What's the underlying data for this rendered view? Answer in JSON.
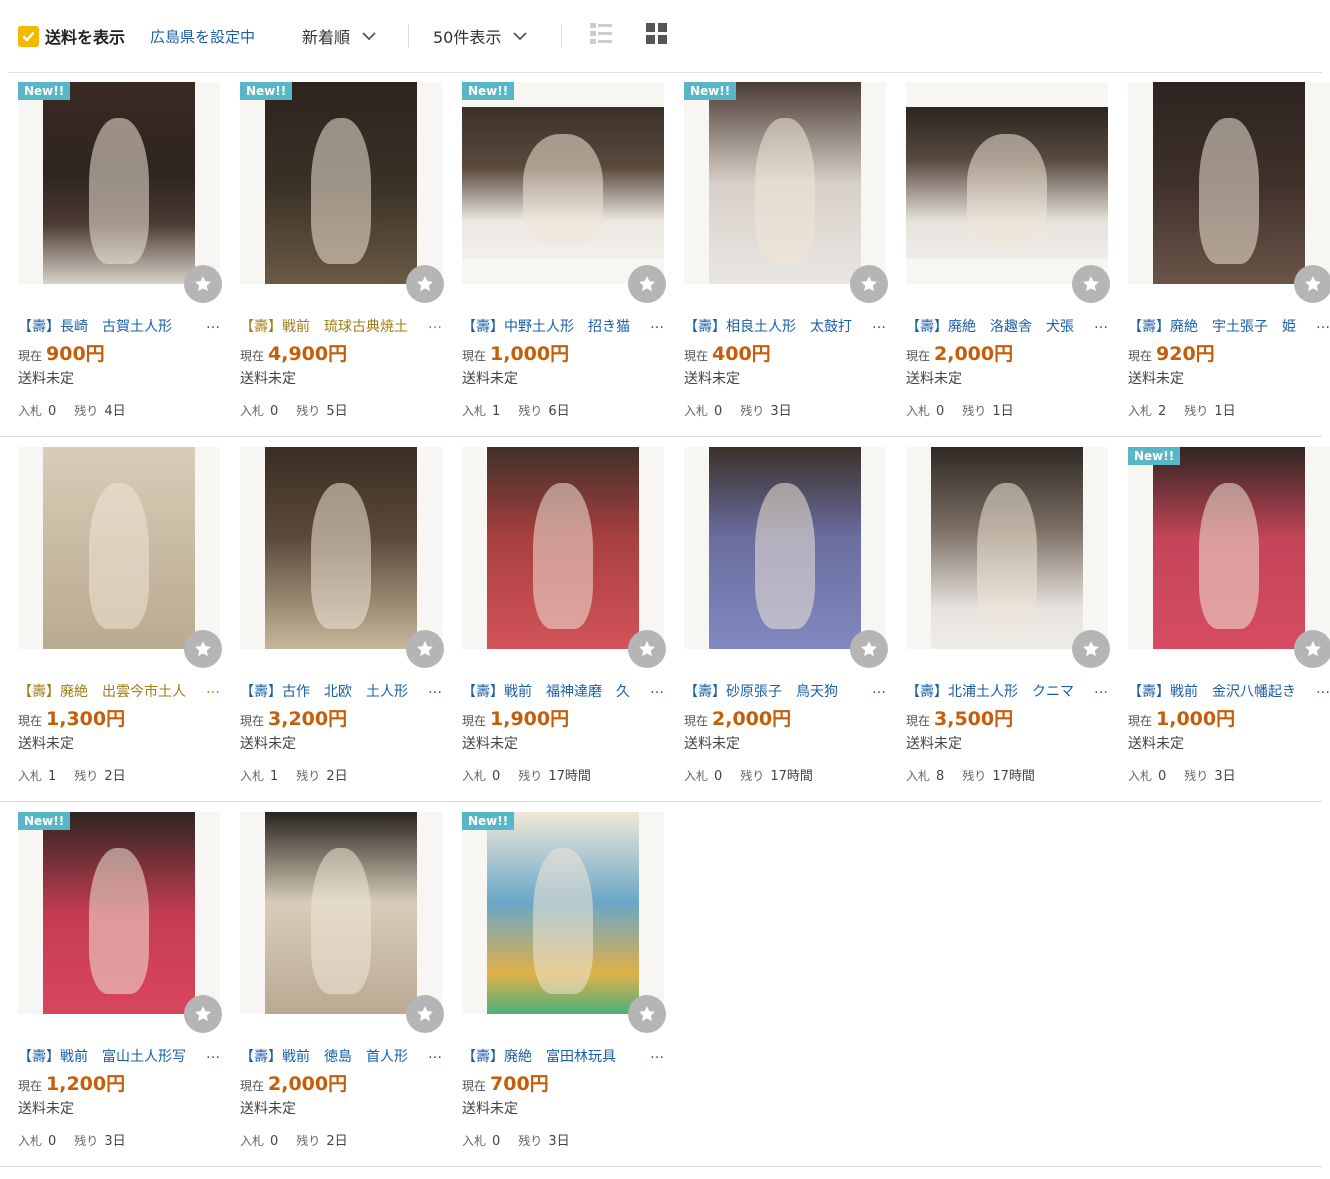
{
  "toolbar": {
    "show_shipping": "送料を表示",
    "pref_link": "広島県を設定中",
    "sort": "新着順",
    "per_page": "50件表示"
  },
  "colors": {
    "accent": "#f5b800",
    "link": "#1a5fa8",
    "price": "#c45e0a",
    "badge": "#58b6c6"
  },
  "labels": {
    "price_prefix": "現在",
    "bids_prefix": "入札",
    "remaining_prefix": "残り",
    "new_badge": "New!!",
    "ellipsis": "…"
  },
  "items": [
    {
      "title": "【壽】長崎　古賀土人形　",
      "price": "900円",
      "shipping": "送料未定",
      "bids": "0",
      "remaining": "4日",
      "is_new": true
    },
    {
      "title": "【壽】戦前　琉球古典焼土",
      "price": "4,900円",
      "shipping": "送料未定",
      "bids": "0",
      "remaining": "5日",
      "is_new": true
    },
    {
      "title": "【壽】中野土人形　招き猫",
      "price": "1,000円",
      "shipping": "送料未定",
      "bids": "1",
      "remaining": "6日",
      "is_new": true
    },
    {
      "title": "【壽】相良土人形　太鼓打",
      "price": "400円",
      "shipping": "送料未定",
      "bids": "0",
      "remaining": "3日",
      "is_new": true
    },
    {
      "title": "【壽】廃絶　洛趣舎　犬張",
      "price": "2,000円",
      "shipping": "送料未定",
      "bids": "0",
      "remaining": "1日",
      "is_new": false
    },
    {
      "title": "【壽】廃絶　宇土張子　姫",
      "price": "920円",
      "shipping": "送料未定",
      "bids": "2",
      "remaining": "1日",
      "is_new": false
    },
    {
      "title": "【壽】廃絶　出雲今市土人",
      "price": "1,300円",
      "shipping": "送料未定",
      "bids": "1",
      "remaining": "2日",
      "is_new": false
    },
    {
      "title": "【壽】古作　北欧　土人形",
      "price": "3,200円",
      "shipping": "送料未定",
      "bids": "1",
      "remaining": "2日",
      "is_new": false
    },
    {
      "title": "【壽】戦前　福神達磨　久",
      "price": "1,900円",
      "shipping": "送料未定",
      "bids": "0",
      "remaining": "17時間",
      "is_new": false
    },
    {
      "title": "【壽】砂原張子　鳥天狗　",
      "price": "2,000円",
      "shipping": "送料未定",
      "bids": "0",
      "remaining": "17時間",
      "is_new": false
    },
    {
      "title": "【壽】北浦土人形　クニマ",
      "price": "3,500円",
      "shipping": "送料未定",
      "bids": "8",
      "remaining": "17時間",
      "is_new": false
    },
    {
      "title": "【壽】戦前　金沢八幡起き",
      "price": "1,000円",
      "shipping": "送料未定",
      "bids": "0",
      "remaining": "3日",
      "is_new": true
    },
    {
      "title": "【壽】戦前　富山土人形写",
      "price": "1,200円",
      "shipping": "送料未定",
      "bids": "0",
      "remaining": "3日",
      "is_new": true
    },
    {
      "title": "【壽】戦前　徳島　首人形",
      "price": "2,000円",
      "shipping": "送料未定",
      "bids": "0",
      "remaining": "2日",
      "is_new": false
    },
    {
      "title": "【壽】廃絶　富田林玩具　",
      "price": "700円",
      "shipping": "送料未定",
      "bids": "0",
      "remaining": "3日",
      "is_new": true
    }
  ]
}
